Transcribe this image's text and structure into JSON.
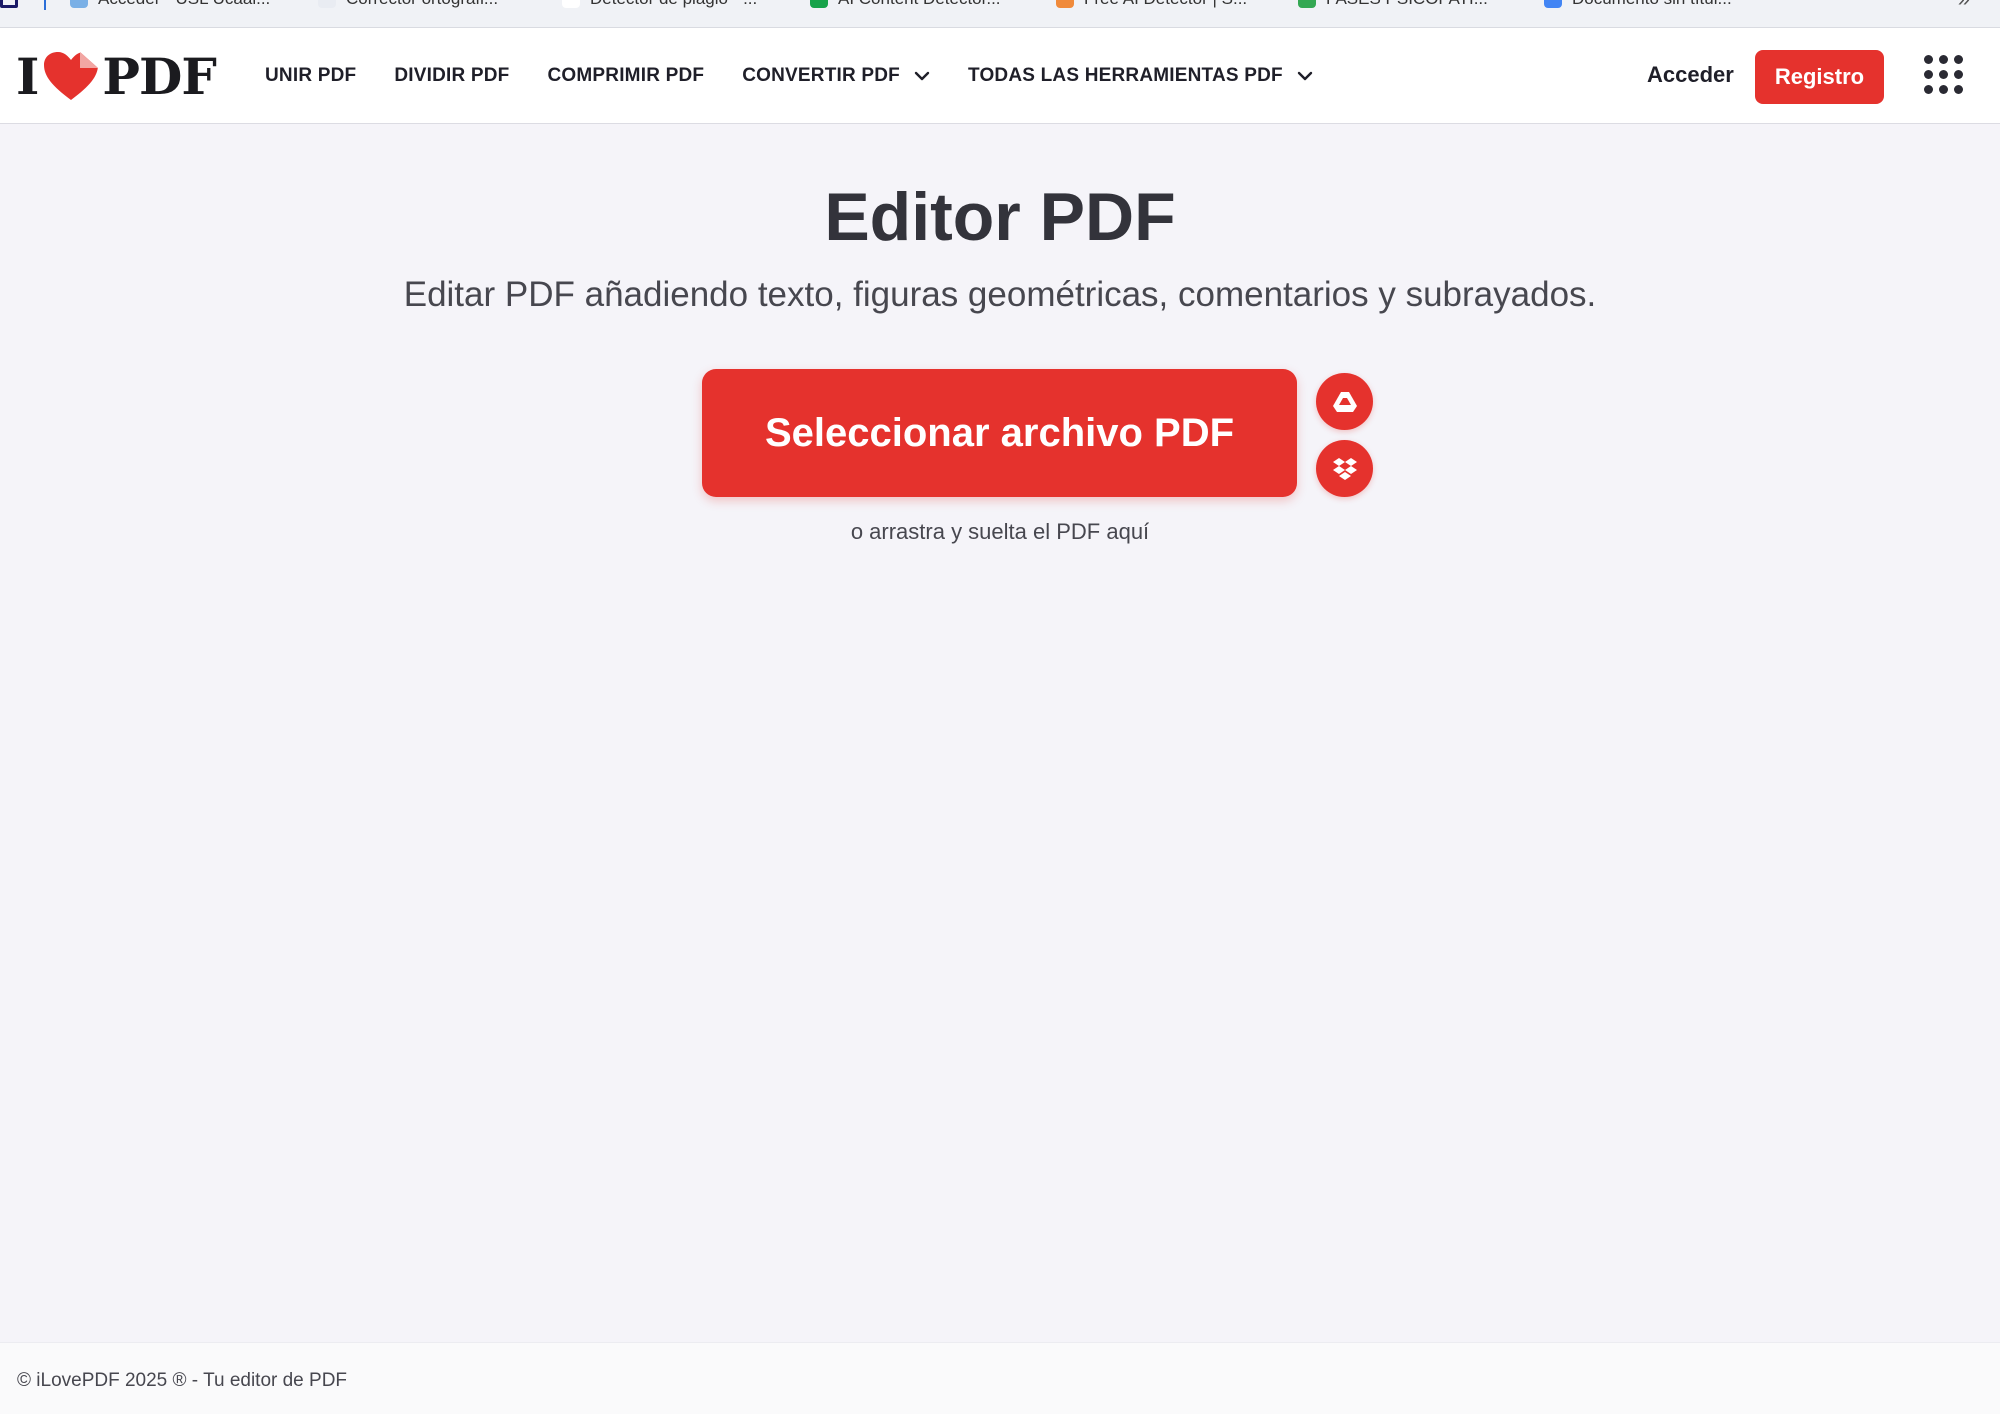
{
  "bookmarks": [
    {
      "label": "Acceder - USL Ucaal...",
      "favicon_color": "#7ab0e6"
    },
    {
      "label": "Corrector ortográfi...",
      "favicon_color": "#e9ecf2"
    },
    {
      "label": "Detector de plagio - ...",
      "favicon_color": "#ffffff"
    },
    {
      "label": "AI Content Detector...",
      "favicon_color": "#17a34a"
    },
    {
      "label": "Free AI Detector | S...",
      "favicon_color": "#f08a3a"
    },
    {
      "label": "FASES PSICOPATI...",
      "favicon_color": "#34a853"
    },
    {
      "label": "Documento sin títul...",
      "favicon_color": "#4285f4"
    }
  ],
  "header": {
    "logo_left": "I",
    "logo_right": "PDF",
    "logo_icon": "heart-icon",
    "nav": [
      {
        "label": "UNIR PDF",
        "has_dropdown": false
      },
      {
        "label": "DIVIDIR PDF",
        "has_dropdown": false
      },
      {
        "label": "COMPRIMIR PDF",
        "has_dropdown": false
      },
      {
        "label": "CONVERTIR PDF",
        "has_dropdown": true
      },
      {
        "label": "TODAS LAS HERRAMIENTAS PDF",
        "has_dropdown": true
      }
    ],
    "login_label": "Acceder",
    "signup_label": "Registro",
    "apps_icon": "grid-menu-icon"
  },
  "main": {
    "title": "Editor PDF",
    "subtitle": "Editar PDF añadiendo texto, figuras geométricas, comentarios y subrayados.",
    "select_button_label": "Seleccionar archivo PDF",
    "cloud_buttons": [
      {
        "icon": "google-drive-icon"
      },
      {
        "icon": "dropbox-icon"
      }
    ],
    "drop_hint": "o arrastra y suelta el PDF aquí"
  },
  "footer": {
    "text": "© iLovePDF 2025 ® - Tu editor de PDF"
  },
  "colors": {
    "brand_red": "#e5322d",
    "page_background": "#f5f4f9",
    "text_dark": "#33333b"
  }
}
